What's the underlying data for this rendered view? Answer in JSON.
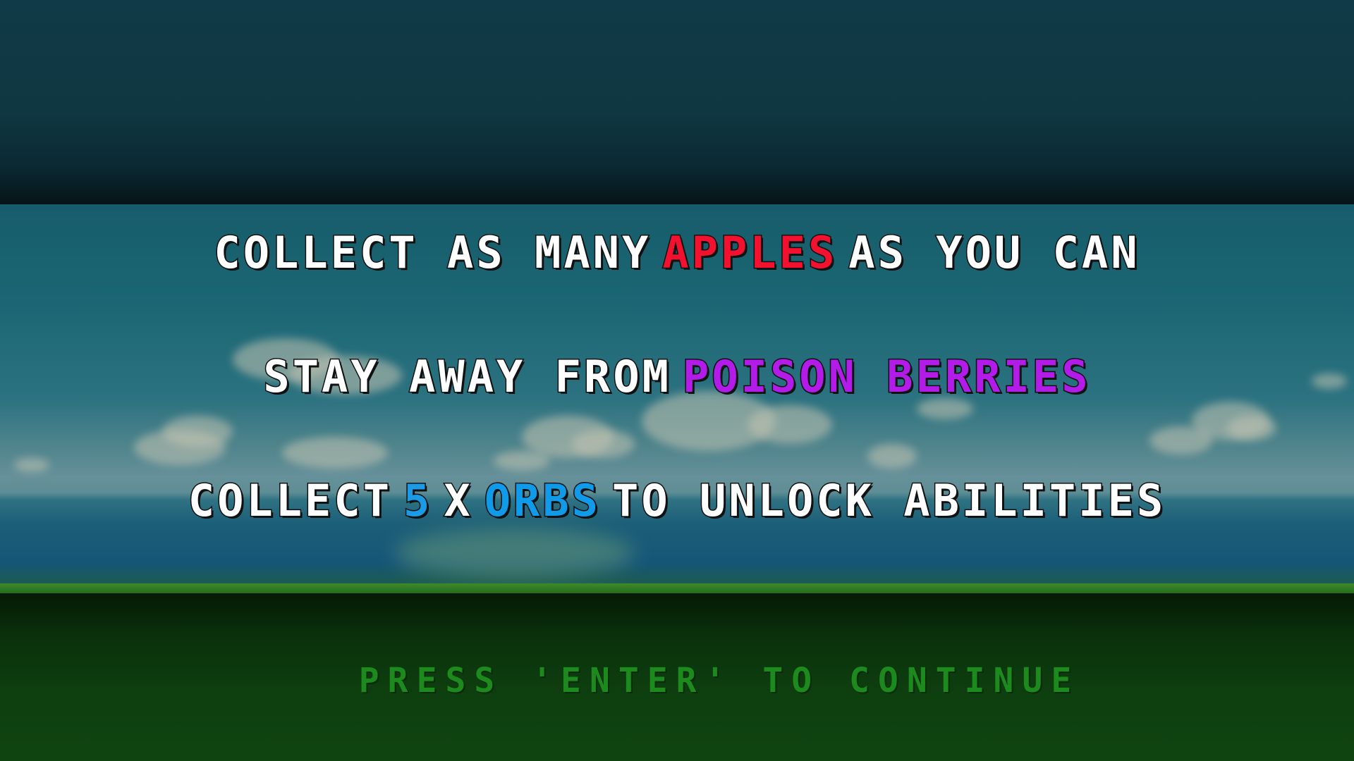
{
  "instructions": {
    "line1": {
      "before": "COLLECT AS MANY",
      "highlight": "APPLES",
      "after": "AS YOU CAN",
      "highlight_color": "#f2112e"
    },
    "line2": {
      "before": "STAY AWAY FROM",
      "highlight": "POISON BERRIES",
      "highlight_color": "#b21be8"
    },
    "line3": {
      "before": "COLLECT",
      "count": "5",
      "times": "X",
      "highlight": "ORBS",
      "after": "TO UNLOCK ABILITIES",
      "highlight_color": "#0f9aea"
    }
  },
  "prompt": "PRESS 'ENTER' TO CONTINUE",
  "colors": {
    "text": "#ffffff",
    "prompt": "#1d8a1d",
    "sky": "#1b6674",
    "ground": "#0e3f0f"
  }
}
